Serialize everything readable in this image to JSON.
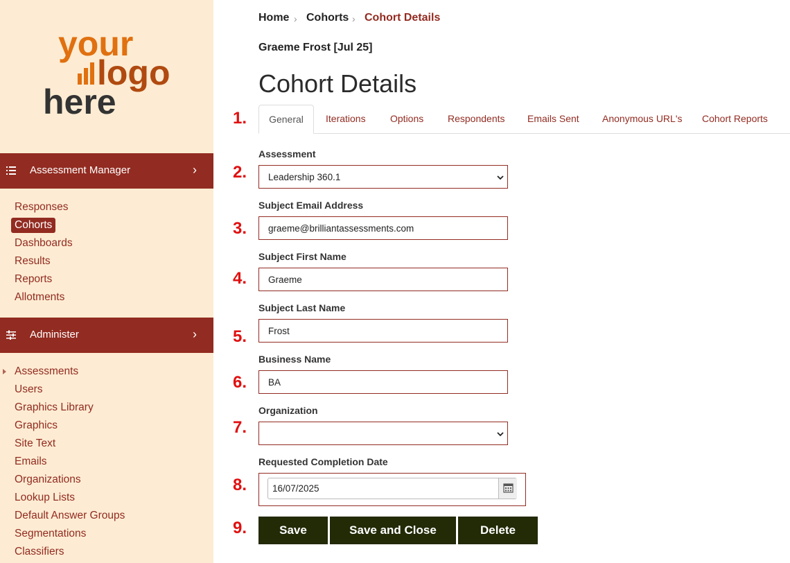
{
  "logo": {
    "line1": "your",
    "line2": "logo",
    "line3": "here"
  },
  "sidebar": {
    "assessment_manager": {
      "title": "Assessment Manager",
      "items": [
        {
          "label": "Responses"
        },
        {
          "label": "Cohorts",
          "active": true
        },
        {
          "label": "Dashboards"
        },
        {
          "label": "Results"
        },
        {
          "label": "Reports"
        },
        {
          "label": "Allotments"
        }
      ]
    },
    "administer": {
      "title": "Administer",
      "items": [
        {
          "label": "Assessments"
        },
        {
          "label": "Users"
        },
        {
          "label": "Graphics Library"
        },
        {
          "label": "Graphics"
        },
        {
          "label": "Site Text"
        },
        {
          "label": "Emails"
        },
        {
          "label": "Organizations"
        },
        {
          "label": "Lookup Lists"
        },
        {
          "label": "Default Answer Groups"
        },
        {
          "label": "Segmentations"
        },
        {
          "label": "Classifiers"
        }
      ]
    }
  },
  "breadcrumb": {
    "home": "Home",
    "cohorts": "Cohorts",
    "current": "Cohort Details"
  },
  "subject": "Graeme Frost [Jul 25]",
  "page_title": "Cohort Details",
  "tabs": [
    {
      "label": "General",
      "active": true
    },
    {
      "label": "Iterations"
    },
    {
      "label": "Options"
    },
    {
      "label": "Respondents"
    },
    {
      "label": "Emails Sent"
    },
    {
      "label": "Anonymous URL's"
    },
    {
      "label": "Cohort Reports"
    }
  ],
  "steps": [
    "1.",
    "2.",
    "3.",
    "4.",
    "5.",
    "6.",
    "7.",
    "8.",
    "9."
  ],
  "form": {
    "assessment": {
      "label": "Assessment",
      "value": "Leadership 360.1"
    },
    "email": {
      "label": "Subject Email Address",
      "value": "graeme@brilliantassessments.com"
    },
    "first_name": {
      "label": "Subject First Name",
      "value": "Graeme"
    },
    "last_name": {
      "label": "Subject Last Name",
      "value": "Frost"
    },
    "business": {
      "label": "Business Name",
      "value": "BA"
    },
    "organization": {
      "label": "Organization",
      "value": ""
    },
    "date": {
      "label": "Requested Completion Date",
      "value": "16/07/2025"
    }
  },
  "buttons": {
    "save": "Save",
    "save_close": "Save and Close",
    "delete": "Delete"
  },
  "colors": {
    "brand": "#922b21",
    "sidebar_bg": "#fdecd3",
    "button": "#222a06",
    "step": "#e01010"
  }
}
